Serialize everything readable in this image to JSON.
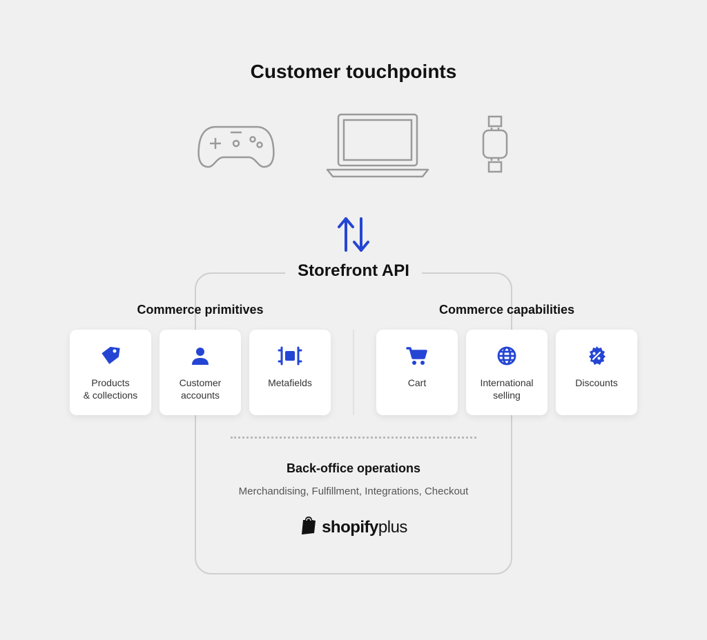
{
  "title": "Customer touchpoints",
  "touchpoints": [
    {
      "name": "game-controller"
    },
    {
      "name": "laptop"
    },
    {
      "name": "smart-watch"
    }
  ],
  "api_label": "Storefront API",
  "columns": {
    "left": {
      "heading": "Commerce primitives",
      "cards": [
        {
          "icon": "tag",
          "label": "Products\n& collections"
        },
        {
          "icon": "user",
          "label": "Customer\naccounts"
        },
        {
          "icon": "metafield",
          "label": "Metafields"
        }
      ]
    },
    "right": {
      "heading": "Commerce capabilities",
      "cards": [
        {
          "icon": "cart",
          "label": "Cart"
        },
        {
          "icon": "globe",
          "label": "International\nselling"
        },
        {
          "icon": "discount",
          "label": "Discounts"
        }
      ]
    }
  },
  "backoffice": {
    "title": "Back-office operations",
    "sub": "Merchandising, Fulfillment, Integrations, Checkout"
  },
  "logo": {
    "brand": "shopify",
    "suffix": "plus"
  },
  "colors": {
    "accent": "#2445d4",
    "icon_outline": "#9a9a9a"
  }
}
